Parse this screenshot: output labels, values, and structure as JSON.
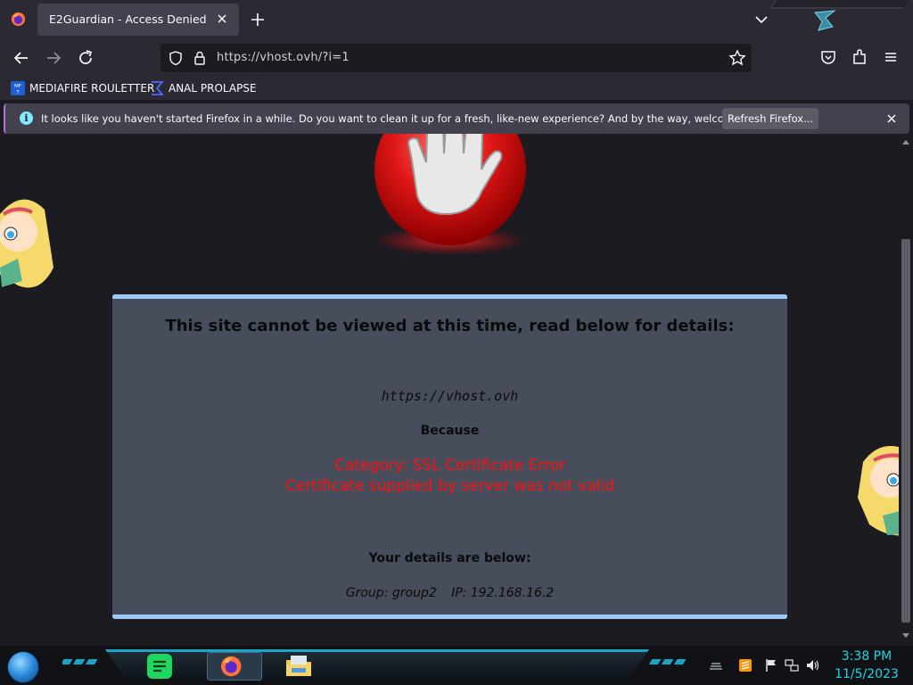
{
  "browser": {
    "tab_title": "E2Guardian - Access Denied",
    "url": "https://vhost.ovh/?i=1"
  },
  "bookmarks": [
    {
      "label": "MEDIAFIRE ROULETTER",
      "icon": "mediafire-icon"
    },
    {
      "label": "ANAL PROLAPSE",
      "icon": "sigma-icon"
    }
  ],
  "notification": {
    "message": "It looks like you haven't started Firefox in a while. Do you want to clean it up for a fresh, like-new experience? And by the way, welcome back!",
    "button": "Refresh Firefox..."
  },
  "denied": {
    "heading": "This site cannot be viewed at this time, read below for details:",
    "blocked_url": "https://vhost.ovh",
    "because": "Because",
    "category": "Category: SSL Certificate Error",
    "reason": "Certificate supplied by server was not valid",
    "details_heading": "Your details are below:",
    "group": "Group: group2",
    "ip": "IP: 192.168.16.2"
  },
  "taskbar": {
    "time": "3:38 PM",
    "date": "11/5/2023",
    "apps": [
      "spotify-icon",
      "firefox-icon",
      "file-explorer-icon"
    ]
  },
  "colors": {
    "error_red": "#ff1010",
    "box_bg": "#474d5b",
    "box_border": "#9ec8f5",
    "clock_cyan": "#22d3e6"
  }
}
